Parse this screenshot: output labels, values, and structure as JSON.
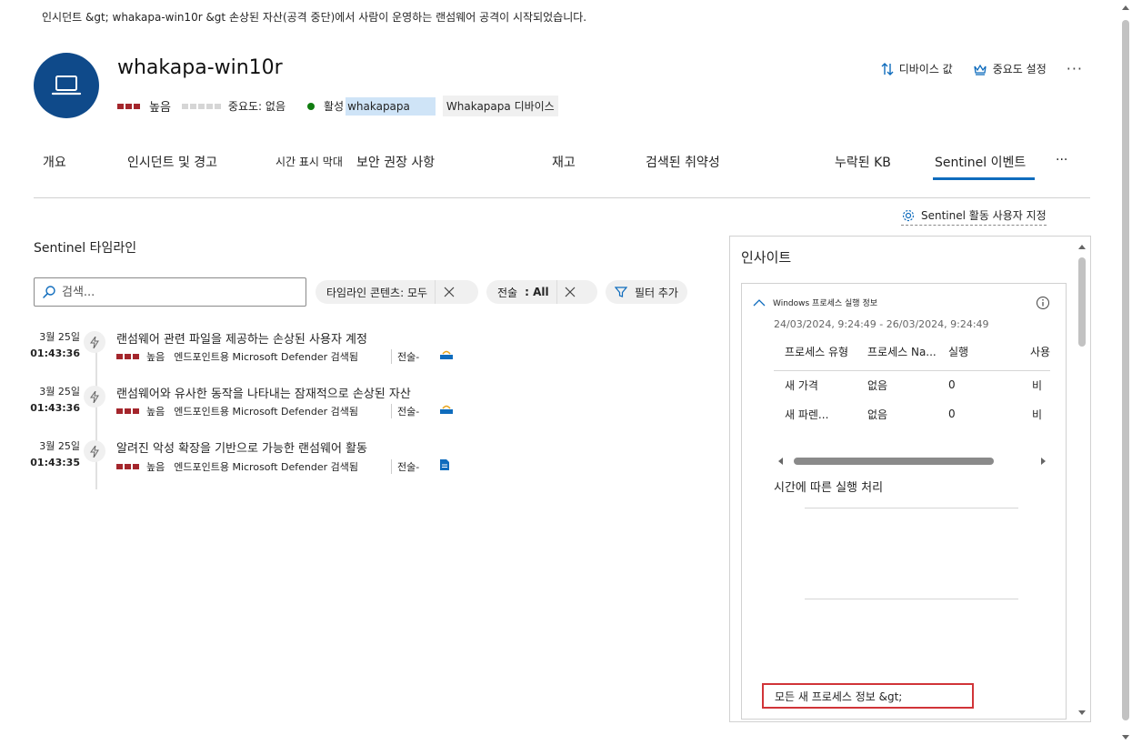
{
  "breadcrumb": "인시던트 &gt;  whakapa-win10r &gt 손상된 자산(공격 중단)에서 사람이 운영하는 랜섬웨어 공격이 시작되었습니다.",
  "device": {
    "name": "whakapa-win10r",
    "risk_label": "높음",
    "criticality_label": "중요도: 없음",
    "status": "활성",
    "status_value": "whakapapa",
    "device_tag": "Whakapapa 디바이스"
  },
  "header_actions": {
    "device_value": "디바이스 값",
    "set_criticality": "중요도 설정",
    "more": "···"
  },
  "tabs": [
    "개요",
    "인시던트 및 경고",
    "시간 표시 막대",
    "보안 권장 사항",
    "재고",
    "검색된 취약성",
    "누락된 KB",
    "Sentinel 이벤트",
    "···"
  ],
  "active_tab": "Sentinel 이벤트",
  "sentinel_custom": "Sentinel 활동 사용자 지정",
  "timeline_title": "Sentinel 타임라인",
  "search": {
    "placeholder": "검색..."
  },
  "filters": {
    "content": "타임라인 콘텐츠: 모두",
    "technique_label": "전술",
    "technique_value": ": All",
    "add_filter": "필터 추가"
  },
  "timeline": [
    {
      "date": "3월 25일",
      "time": "01:43:36",
      "title": "랜섬웨어 관련 파일을 제공하는 손상된 사용자 계정",
      "severity": "높음",
      "source": "엔드포인트용 Microsoft Defender 검색됨",
      "tactic": "전술-"
    },
    {
      "date": "3월 25일",
      "time": "01:43:36",
      "title": "랜섬웨어와 유사한 동작을 나타내는 잠재적으로 손상된 자산",
      "severity": "높음",
      "source": "엔드포인트용 Microsoft Defender 검색됨",
      "tactic": "전술-"
    },
    {
      "date": "3월 25일",
      "time": "01:43:35",
      "title": "알려진 악성 확장을 기반으로 가능한 랜섬웨어 활동",
      "severity": "높음",
      "source": "엔드포인트용 Microsoft Defender 검색됨",
      "tactic": "전술-"
    }
  ],
  "insights": {
    "title": "인사이트",
    "card_title": "Windows 프로세스 실행 정보",
    "range": "24/03/2024, 9:24:49 - 26/03/2024, 9:24:49",
    "columns": [
      "프로세스 유형",
      "프로세스 Na...",
      "실행",
      "사용"
    ],
    "rows": [
      [
        "새 가격",
        "없음",
        "0",
        "비"
      ],
      [
        "새 파렌...",
        "없음",
        "0",
        "비"
      ]
    ],
    "chart_title": "시간에 따른 실행 처리",
    "all_link": "모든 새 프로세스 정보 &gt;"
  },
  "colors": {
    "accent": "#0f6cbd",
    "severity_high": "#a4262c",
    "avatar": "#0f4a8a",
    "highlight_border": "#d13438"
  }
}
